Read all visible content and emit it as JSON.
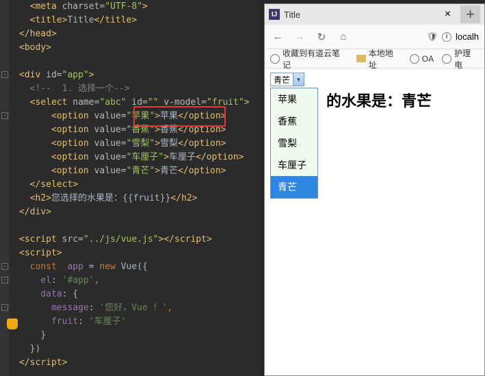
{
  "code": {
    "l1_open": "<meta ",
    "l1_a1": "charset=",
    "l1_v1": "\"UTF-8\"",
    "l1_close": ">",
    "l2a": "<title>",
    "l2_txt": "Title",
    "l2b": "</title>",
    "l3": "</head>",
    "l4": "<body>",
    "l6a": "<div ",
    "l6_a1": "id=",
    "l6_v1": "\"app\"",
    "l6b": ">",
    "l7": "<!--  1. 选择一个-->",
    "l8a": "<select ",
    "l8_a1": "name=",
    "l8_v1": "\"abc\" ",
    "l8_a2": "id=",
    "l8_v2": "\"\" ",
    "l8_a3": "v-model=",
    "l8_v3": "\"fruit\"",
    "l8b": ">",
    "l9a": "<option ",
    "l9_a1": "value=",
    "l9_v1": "\"苹果\"",
    "l9b": ">",
    "l9_txt": "苹果",
    "l9c": "</option>",
    "l10a": "<option ",
    "l10_a1": "value=",
    "l10_v1": "\"香蕉\"",
    "l10b": ">",
    "l10_txt": "香蕉",
    "l10c": "</option>",
    "l11a": "<option ",
    "l11_a1": "value=",
    "l11_v1": "\"雪梨\"",
    "l11b": ">",
    "l11_txt": "雪梨",
    "l11c": "</option>",
    "l12a": "<option ",
    "l12_a1": "value=",
    "l12_v1": "\"车厘子\"",
    "l12b": ">",
    "l12_txt": "车厘子",
    "l12c": "</option>",
    "l13a": "<option ",
    "l13_a1": "value=",
    "l13_v1": "\"青芒\"",
    "l13b": ">",
    "l13_txt": "青芒",
    "l13c": "</option>",
    "l14": "</select>",
    "l15a": "<h2>",
    "l15_txt": "您选择的水果是：{{fruit}}",
    "l15b": "</h2>",
    "l16": "</div>",
    "l18a": "<script ",
    "l18_a1": "src=",
    "l18_v1": "\"../js/vue.js\"",
    "l18b": "></",
    "l18c": "script>",
    "l19a": "<script>",
    "l19c": "",
    "l20_k": "const  ",
    "l20_var": "app",
    "l20_eq": " = ",
    "l20_new": "new ",
    "l20_fn": "Vue",
    "l20_p": "({",
    "l21_k": "el",
    "l21_c": ": ",
    "l21_v": "'#app'",
    "l21_cm": ",",
    "l22_k": "data",
    "l22_c": ": {",
    "l23_k": "message",
    "l23_c": ": ",
    "l23_v": "'您好，Vue ！'",
    "l23_cm": ",",
    "l24_k": "fruit",
    "l24_c": ": ",
    "l24_v": "'车厘子'",
    "l25": "}",
    "l26": "})",
    "l27a": "</",
    "l27b": "script>"
  },
  "browser": {
    "title": "Title",
    "url": "localh",
    "bookmarks": [
      "收藏到有道云笔记",
      "本地地址",
      "OA",
      "护理电"
    ],
    "select_value": "青芒",
    "options": [
      "苹果",
      "香蕉",
      "雪梨",
      "车厘子",
      "青芒"
    ],
    "heading": "的水果是：青芒"
  }
}
